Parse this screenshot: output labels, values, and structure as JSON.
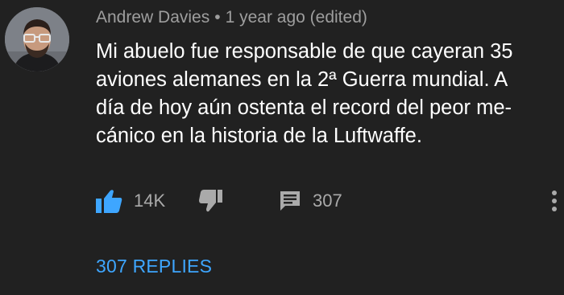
{
  "author": "Andrew Davies",
  "separator": "•",
  "timestamp": "1 year ago (edited)",
  "comment_lines": [
    "Mi abuelo fue responsable de que cayeran 35",
    "aviones alemanes en la 2ª Guerra mundial. A",
    "día de hoy aún ostenta el record del peor me-",
    "cánico en la historia de la Luftwaffe."
  ],
  "actions": {
    "like_count": "14K",
    "reply_count": "307"
  },
  "replies_link": "307 REPLIES",
  "colors": {
    "background": "#212121",
    "like_active": "#3ea6ff",
    "link": "#3ea6ff",
    "icon": "#aaaaaa"
  },
  "icons": [
    "thumbs-up-icon",
    "thumbs-down-icon",
    "comment-icon",
    "more-vert-icon"
  ]
}
